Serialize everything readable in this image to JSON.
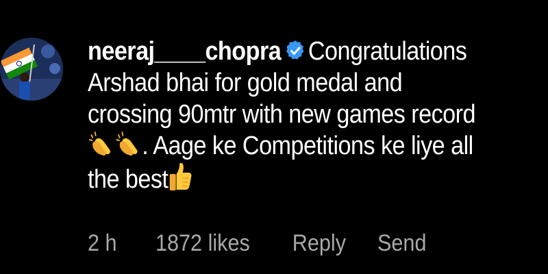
{
  "comment": {
    "username": "neeraj____chopra",
    "verified_icon": "verified-badge-icon",
    "line1_text": "Congratulations",
    "line2": "Arshad bhai for gold medal and",
    "line3": "crossing 90mtr with new games record",
    "line4_text": ". Aage ke Competitions ke liye all",
    "line5_text": "the best",
    "emojis": [
      "clapping-hands-icon",
      "clapping-hands-icon",
      "thumbs-up-icon"
    ]
  },
  "meta": {
    "time": "2 h",
    "likes": "1872 likes",
    "reply_label": "Reply",
    "send_label": "Send"
  },
  "colors": {
    "background": "#000000",
    "text": "#ffffff",
    "secondary_text": "#a8a8a8",
    "verified_blue": "#3897f0"
  }
}
